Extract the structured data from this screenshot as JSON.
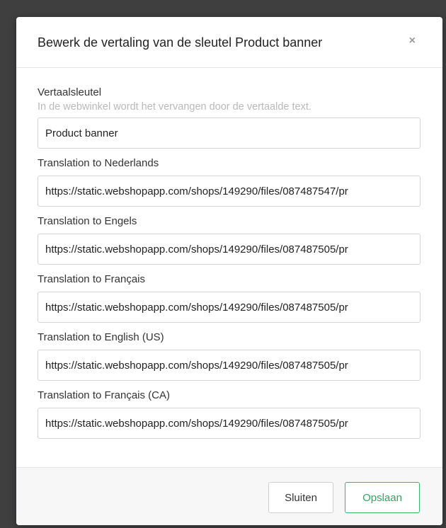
{
  "modal": {
    "title": "Bewerk de vertaling van de sleutel Product banner",
    "close_glyph": "×",
    "key_field": {
      "label": "Vertaalsleutel",
      "help": "In de webwinkel wordt het vervangen door de vertaalde text.",
      "value": "Product banner"
    },
    "translations": [
      {
        "label": "Translation to Nederlands",
        "value": "https://static.webshopapp.com/shops/149290/files/087487547/pr"
      },
      {
        "label": "Translation to Engels",
        "value": "https://static.webshopapp.com/shops/149290/files/087487505/pr"
      },
      {
        "label": "Translation to Français",
        "value": "https://static.webshopapp.com/shops/149290/files/087487505/pr"
      },
      {
        "label": "Translation to English (US)",
        "value": "https://static.webshopapp.com/shops/149290/files/087487505/pr"
      },
      {
        "label": "Translation to Français (CA)",
        "value": "https://static.webshopapp.com/shops/149290/files/087487505/pr"
      }
    ],
    "footer": {
      "close_label": "Sluiten",
      "save_label": "Opslaan"
    }
  },
  "colors": {
    "save_accent": "#2ea95e",
    "help_text": "#b9b9b9"
  }
}
